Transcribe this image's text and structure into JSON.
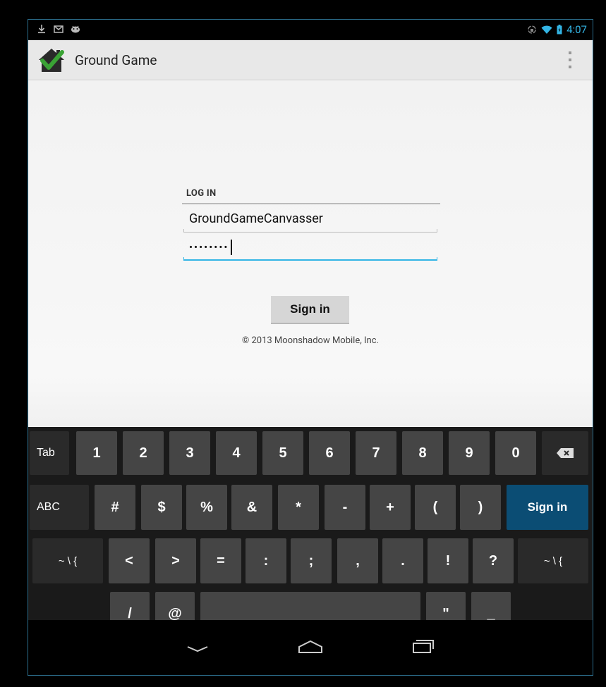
{
  "status_bar": {
    "time": "4:07",
    "left_icons": [
      "download-icon",
      "gmail-icon",
      "android-icon"
    ],
    "right_icons": [
      "rotation-lock-icon",
      "wifi-icon",
      "battery-icon"
    ]
  },
  "action_bar": {
    "title": "Ground Game",
    "logo_icon": "house-check-logo-icon",
    "overflow_icon": "overflow-menu-icon"
  },
  "login": {
    "section_label": "LOG IN",
    "username_value": "GroundGameCanvasser",
    "password_value": "••••••••",
    "signin_label": "Sign in",
    "copyright": "© 2013 Moonshadow Mobile, Inc."
  },
  "keyboard": {
    "row1": [
      "Tab",
      "1",
      "2",
      "3",
      "4",
      "5",
      "6",
      "7",
      "8",
      "9",
      "0"
    ],
    "row1_delete_icon": "backspace-icon",
    "row2": [
      "ABC",
      "#",
      "$",
      "%",
      "&",
      "*",
      "-",
      "+",
      "(",
      ")",
      "Sign in"
    ],
    "row3": [
      "~ \\ {",
      "<",
      ">",
      "=",
      ":",
      ";",
      ",",
      ".",
      "!",
      "?",
      "~ \\ {"
    ],
    "row4": [
      "/",
      "@",
      " ",
      "\"",
      "_"
    ]
  },
  "nav_bar": {
    "icons": [
      "back-icon",
      "home-icon",
      "recent-apps-icon"
    ]
  },
  "colors": {
    "accent": "#33b5e5",
    "action_key": "#0b4d74",
    "logo_green": "#3aa335"
  }
}
